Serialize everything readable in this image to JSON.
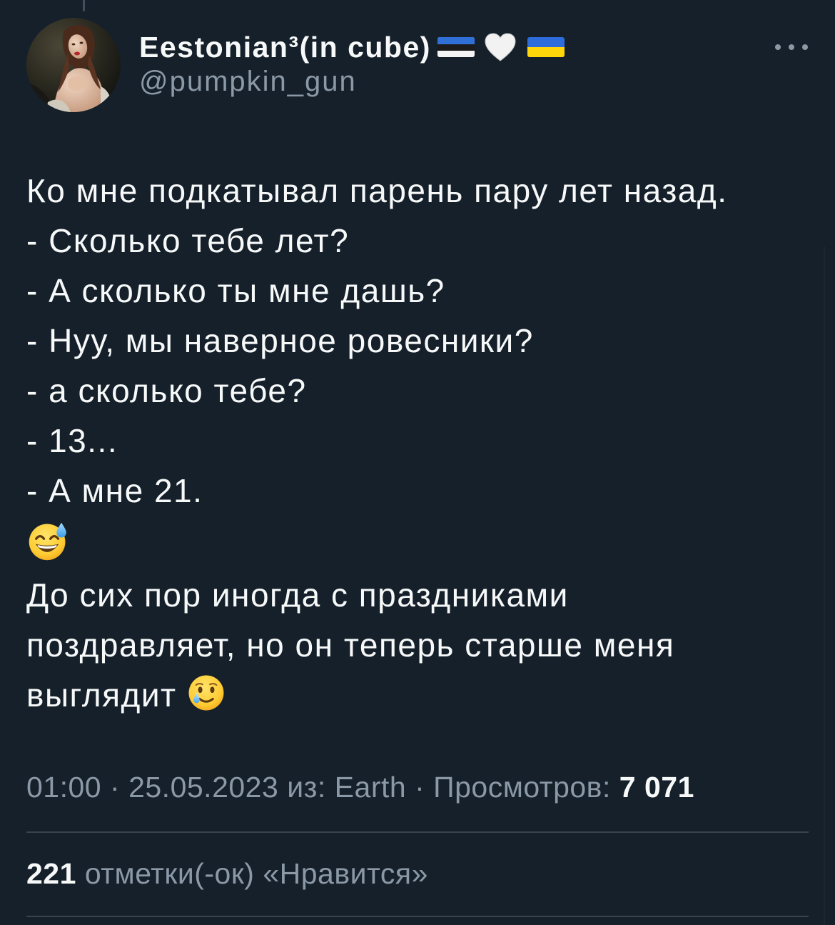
{
  "theme": {
    "background": "#15202B",
    "text_primary": "#F7F9F9",
    "text_secondary": "#8B98A5",
    "divider": "#38444D"
  },
  "author": {
    "display_name": "Eestonian³(in cube)",
    "name_badges": [
      "estonia-flag-icon",
      "white-heart-icon",
      "ukraine-flag-icon"
    ],
    "handle": "@pumpkin_gun"
  },
  "header": {
    "more_icon": "more-options-icon"
  },
  "tweet": {
    "lines": [
      "Ко мне подкатывал парень пару лет назад.",
      "- Сколько тебе лет?",
      "- А сколько ты мне дашь?",
      "- Нуу, мы наверное ровесники?",
      "- а сколько тебе?",
      "- 13...",
      "- А мне 21."
    ],
    "emoji_line_icon": "grinning-face-with-sweat-icon",
    "closing_lines": [
      "До сих пор иногда с праздниками",
      "поздравляет, но он теперь старше меня",
      "выглядит"
    ],
    "closing_emoji_icon": "smiling-face-with-tear-icon"
  },
  "meta": {
    "time": "01:00",
    "separator": "·",
    "date": "25.05.2023",
    "source": "из: Earth",
    "views_label": "Просмотров:",
    "views_count": "7 071"
  },
  "likes": {
    "count": "221",
    "label": "отметки(-ок) «Нравится»"
  }
}
